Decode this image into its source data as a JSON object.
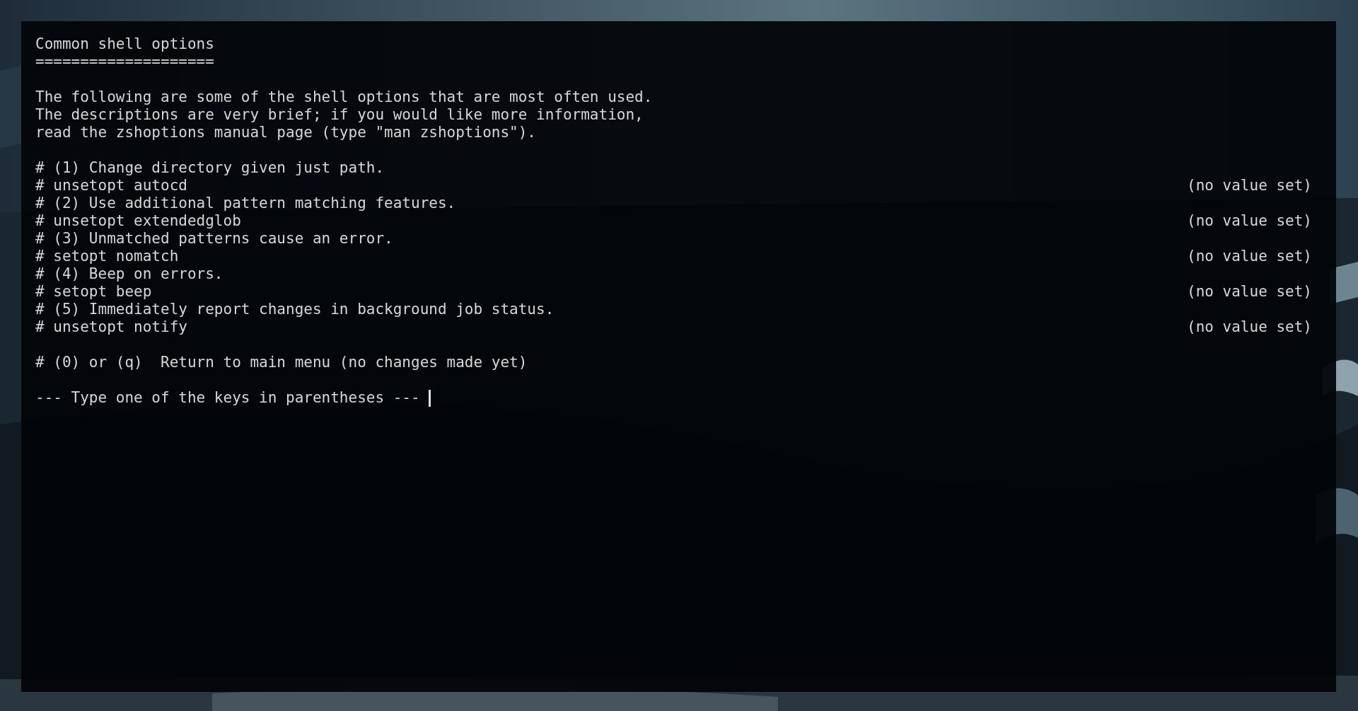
{
  "terminal": {
    "lines": [
      {
        "kind": "text",
        "text": "Common shell options"
      },
      {
        "kind": "text",
        "text": "===================="
      },
      {
        "kind": "blank"
      },
      {
        "kind": "text",
        "text": "The following are some of the shell options that are most often used."
      },
      {
        "kind": "text",
        "text": "The descriptions are very brief; if you would like more information,"
      },
      {
        "kind": "text",
        "text": "read the zshoptions manual page (type \"man zshoptions\")."
      },
      {
        "kind": "blank"
      },
      {
        "kind": "text",
        "text": "# (1) Change directory given just path."
      },
      {
        "kind": "option",
        "text": "# unsetopt autocd",
        "value": "(no value set)"
      },
      {
        "kind": "text",
        "text": "# (2) Use additional pattern matching features."
      },
      {
        "kind": "option",
        "text": "# unsetopt extendedglob",
        "value": "(no value set)"
      },
      {
        "kind": "text",
        "text": "# (3) Unmatched patterns cause an error."
      },
      {
        "kind": "option",
        "text": "# setopt nomatch",
        "value": "(no value set)"
      },
      {
        "kind": "text",
        "text": "# (4) Beep on errors."
      },
      {
        "kind": "option",
        "text": "# setopt beep",
        "value": "(no value set)"
      },
      {
        "kind": "text",
        "text": "# (5) Immediately report changes in background job status."
      },
      {
        "kind": "option",
        "text": "# unsetopt notify",
        "value": "(no value set)"
      },
      {
        "kind": "blank"
      },
      {
        "kind": "text",
        "text": "# (0) or (q)  Return to main menu (no changes made yet)"
      },
      {
        "kind": "blank"
      },
      {
        "kind": "prompt",
        "text": "--- Type one of the keys in parentheses --- "
      }
    ]
  }
}
